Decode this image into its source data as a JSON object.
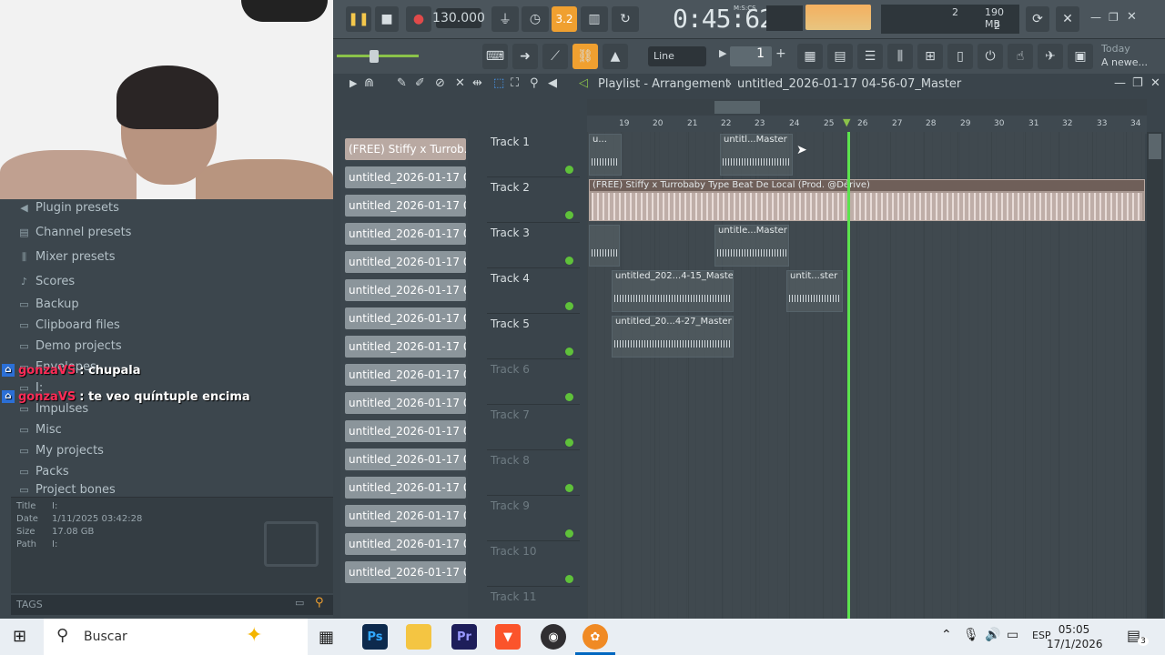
{
  "webcam": {
    "label": "webcam overlay"
  },
  "browser": {
    "items": [
      {
        "label": "Plugin presets",
        "icon": "plug-icon"
      },
      {
        "label": "Channel presets",
        "icon": "channel-icon"
      },
      {
        "label": "Mixer presets",
        "icon": "mixer-icon"
      },
      {
        "label": "Scores",
        "icon": "note-icon"
      },
      {
        "label": "Backup",
        "icon": "folder-icon"
      },
      {
        "label": "Clipboard files",
        "icon": "folder-icon"
      },
      {
        "label": "Demo projects",
        "icon": "folder-icon"
      },
      {
        "label": "Envelopes",
        "icon": "folder-icon"
      },
      {
        "label": "I:",
        "icon": "folder-icon"
      },
      {
        "label": "Impulses",
        "icon": "folder-icon"
      },
      {
        "label": "Misc",
        "icon": "folder-icon"
      },
      {
        "label": "My projects",
        "icon": "folder-icon"
      },
      {
        "label": "Packs",
        "icon": "folder-icon"
      },
      {
        "label": "Project bones",
        "icon": "folder-icon"
      }
    ],
    "chat": [
      {
        "user": "gonzaVS",
        "message": ": chupala"
      },
      {
        "user": "gonzaVS",
        "message": ": te veo quíntuple encima"
      }
    ],
    "info": {
      "title_label": "Title",
      "title": "I:",
      "date_label": "Date",
      "date": "1/11/2025 03:42:28",
      "size_label": "Size",
      "size": "17.08 GB",
      "path_label": "Path",
      "path": "I:"
    },
    "tags_label": "TAGS"
  },
  "toolbar": {
    "bpm": "130.000",
    "time": "0:45:62",
    "time_unit": "M:S:CS",
    "pattern_value": "3.2",
    "mem_top": "2",
    "mem_mb": "190 MB",
    "mem_bottom": "2",
    "snap": "Line",
    "pattern_num": "1",
    "hint_today": "Today",
    "hint_news": "A newe..."
  },
  "playlist": {
    "title": "Playlist - Arrangement",
    "project": "untitled_2026-01-17 04-56-07_Master",
    "ruler": [
      "19",
      "20",
      "21",
      "22",
      "23",
      "24",
      "25",
      "26",
      "27",
      "28",
      "29",
      "30",
      "31",
      "32",
      "33",
      "34"
    ],
    "tracks": [
      "Track 1",
      "Track 2",
      "Track 3",
      "Track 4",
      "Track 5",
      "Track 6",
      "Track 7",
      "Track 8",
      "Track 9",
      "Track 10",
      "Track 11"
    ],
    "clip_list": [
      "(FREE) Stiffy x Turrob...",
      "untitled_2026-01-17 04-...",
      "untitled_2026-01-17 04-...",
      "untitled_2026-01-17 04-...",
      "untitled_2026-01-17 04-...",
      "untitled_2026-01-17 04-...",
      "untitled_2026-01-17 04-...",
      "untitled_2026-01-17 04-...",
      "untitled_2026-01-17 04-...",
      "untitled_2026-01-17 04-...",
      "untitled_2026-01-17 04-...",
      "untitled_2026-01-17 04-...",
      "untitled_2026-01-17 04-...",
      "untitled_2026-01-17 04-...",
      "untitled_2026-01-17 04-...",
      "untitled_2026-01-17 04-..."
    ],
    "clips": {
      "t1a": "u...",
      "t1b": "untitl...Master",
      "t2": "(FREE) Stiffy x Turrobaby Type Beat  De Local (Prod. @Dérive)",
      "t3a": "",
      "t3b": "untitle...Master",
      "t4a": "untitled_202...4-15_Master",
      "t4b": "untit...ster",
      "t5a": "untitled_20...4-27_Master"
    }
  },
  "taskbar": {
    "search": "Buscar",
    "lang": "ESP",
    "time": "05:05",
    "date": "17/1/2026",
    "notif": "3",
    "apps": [
      "Ps",
      "Pr"
    ]
  }
}
